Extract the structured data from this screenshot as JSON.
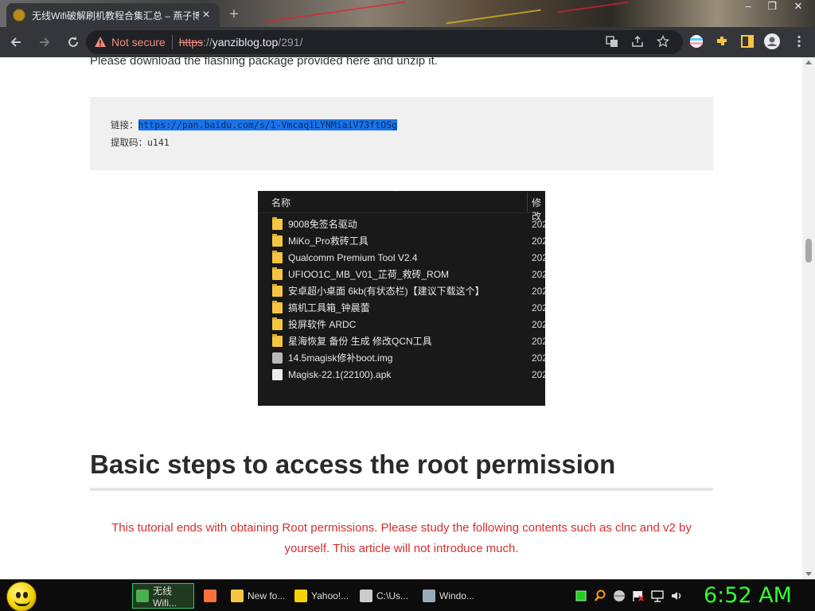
{
  "browser": {
    "tab_title": "无线Wifi破解刷机教程合集汇总 – 燕子博客",
    "tab_close": "×",
    "new_tab": "+",
    "window_controls": {
      "minimize": "–",
      "maximize": "❐",
      "close": "✕"
    },
    "security_label": "Not secure",
    "url_scheme": "https",
    "url_separator": "://",
    "url_host": "yanziblog.top",
    "url_path": "/291/"
  },
  "page": {
    "intro": "Please download the flashing package provided here and unzip it.",
    "code_line1_prefix": "链接：",
    "code_link": "https://pan.baidu.com/s/1-VmcaqiLYNMiaiV73ftOSg",
    "code_line2": "提取码：u141",
    "heading": "Basic steps to access the root permission",
    "notice": "This tutorial ends with obtaining Root permissions. Please study the following contents such as clnc and v2 by yourself. This article will not introduce much."
  },
  "file_explorer": {
    "column_name": "名称",
    "column_modified": "修改",
    "close_mark": "×",
    "files": [
      {
        "name": "9008免签名驱动",
        "date": "202",
        "kind": "folder"
      },
      {
        "name": "MiKo_Pro救砖工具",
        "date": "202",
        "kind": "folder"
      },
      {
        "name": "Qualcomm Premium Tool V2.4",
        "date": "202",
        "kind": "folder"
      },
      {
        "name": "UFIOO1C_MB_V01_芷荷_救砖_ROM",
        "date": "202",
        "kind": "folder"
      },
      {
        "name": "安卓超小桌面 6kb(有状态栏)【建议下载这个】",
        "date": "202",
        "kind": "folder"
      },
      {
        "name": "搞机工具箱_钟晨蕾",
        "date": "202",
        "kind": "folder"
      },
      {
        "name": "投屏软件 ARDC",
        "date": "202",
        "kind": "folder"
      },
      {
        "name": "星海恢复 备份 生成 修改QCN工具",
        "date": "202",
        "kind": "folder"
      },
      {
        "name": "14.5magisk修补boot.img",
        "date": "202",
        "kind": "image"
      },
      {
        "name": "Magisk-22.1(22100).apk",
        "date": "202",
        "kind": "file"
      }
    ]
  },
  "taskbar": {
    "buttons": [
      {
        "label": "无线Wifi...",
        "icon": "chrome-icon",
        "color": "#4caf50"
      },
      {
        "label": "",
        "icon": "firefox-icon",
        "color": "#ff7139"
      },
      {
        "label": "New fo...",
        "icon": "folder-icon",
        "color": "#f5c542"
      },
      {
        "label": "Yahoo!...",
        "icon": "yahoo-icon",
        "color": "#f4d400"
      },
      {
        "label": "C:\\Us...",
        "icon": "cmd-icon",
        "color": "#cccccc"
      },
      {
        "label": "Windo...",
        "icon": "window-icon",
        "color": "#9ab"
      }
    ],
    "clock": "6:52 AM"
  },
  "colors": {
    "chrome_dark": "#35363a",
    "omnibox": "#202124",
    "warning_red": "#f28b82",
    "notice_red": "#d32f2f",
    "clock_green": "#33ff33",
    "selection_blue": "#1a73e8"
  }
}
